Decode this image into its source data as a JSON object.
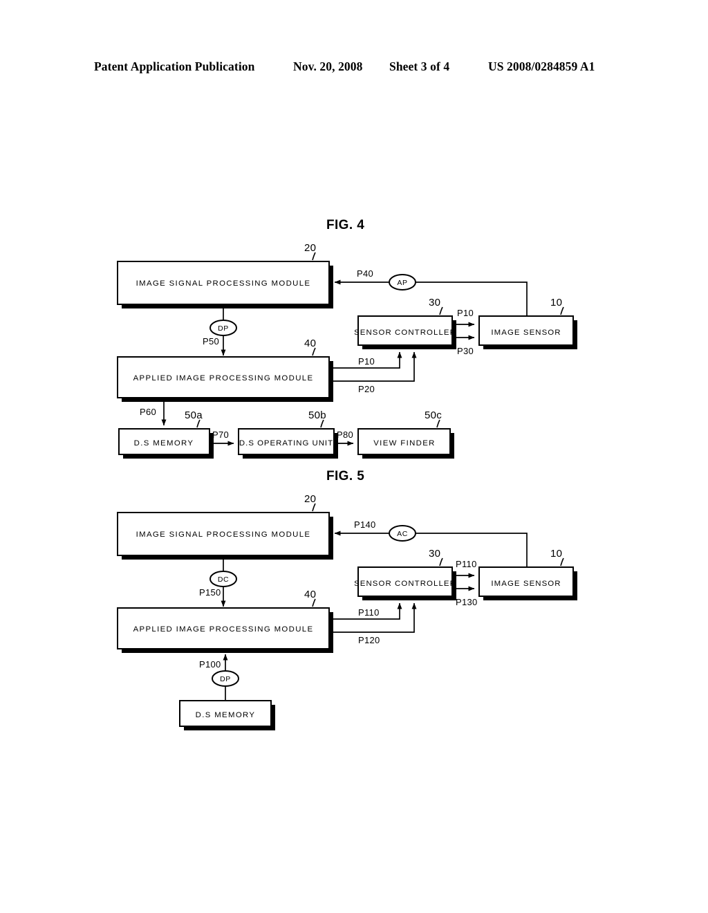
{
  "header": {
    "publication": "Patent Application Publication",
    "date": "Nov. 20, 2008",
    "sheet": "Sheet 3 of 4",
    "document_number": "US 2008/0284859 A1"
  },
  "figures": [
    {
      "id": "fig4",
      "title": "FIG. 4",
      "blocks": [
        {
          "key": "isp",
          "label": "IMAGE SIGNAL PROCESSING MODULE",
          "ref": "20"
        },
        {
          "key": "applied",
          "label": "APPLIED IMAGE PROCESSING MODULE",
          "ref": "40"
        },
        {
          "key": "sensor_ctrl",
          "label": "SENSOR CONTROLLER",
          "ref": "30"
        },
        {
          "key": "image_sensor",
          "label": "IMAGE SENSOR",
          "ref": "10"
        },
        {
          "key": "ds_memory",
          "label": "D.S MEMORY",
          "ref": "50a"
        },
        {
          "key": "ds_operating",
          "label": "D.S OPERATING UNIT",
          "ref": "50b"
        },
        {
          "key": "view_finder",
          "label": "VIEW FINDER",
          "ref": "50c"
        }
      ],
      "nodes": [
        {
          "key": "ap",
          "label": "AP"
        },
        {
          "key": "dp",
          "label": "DP"
        }
      ],
      "signals": [
        {
          "key": "p40",
          "label": "P40"
        },
        {
          "key": "p50",
          "label": "P50"
        },
        {
          "key": "p10a",
          "label": "P10"
        },
        {
          "key": "p30",
          "label": "P30"
        },
        {
          "key": "p10b",
          "label": "P10"
        },
        {
          "key": "p20",
          "label": "P20"
        },
        {
          "key": "p60",
          "label": "P60"
        },
        {
          "key": "p70",
          "label": "P70"
        },
        {
          "key": "p80",
          "label": "P80"
        }
      ]
    },
    {
      "id": "fig5",
      "title": "FIG. 5",
      "blocks": [
        {
          "key": "isp",
          "label": "IMAGE SIGNAL PROCESSING MODULE",
          "ref": "20"
        },
        {
          "key": "applied",
          "label": "APPLIED IMAGE PROCESSING MODULE",
          "ref": "40"
        },
        {
          "key": "sensor_ctrl",
          "label": "SENSOR CONTROLLER",
          "ref": "30"
        },
        {
          "key": "image_sensor",
          "label": "IMAGE SENSOR",
          "ref": "10"
        },
        {
          "key": "ds_memory",
          "label": "D.S MEMORY",
          "ref": ""
        }
      ],
      "nodes": [
        {
          "key": "ac",
          "label": "AC"
        },
        {
          "key": "dc",
          "label": "DC"
        },
        {
          "key": "dp",
          "label": "DP"
        }
      ],
      "signals": [
        {
          "key": "p140",
          "label": "P140"
        },
        {
          "key": "p150",
          "label": "P150"
        },
        {
          "key": "p110a",
          "label": "P110"
        },
        {
          "key": "p130",
          "label": "P130"
        },
        {
          "key": "p110b",
          "label": "P110"
        },
        {
          "key": "p120",
          "label": "P120"
        },
        {
          "key": "p100",
          "label": "P100"
        }
      ]
    }
  ]
}
